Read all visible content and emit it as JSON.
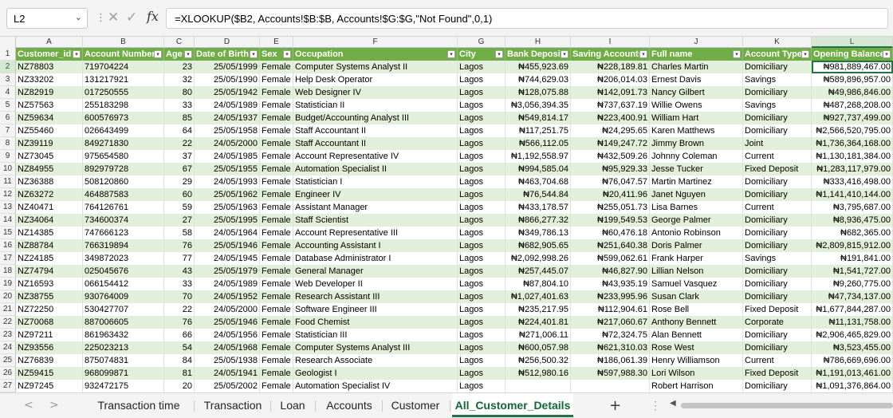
{
  "formula_bar": {
    "name_box": "L2",
    "name_box_arrow": "⌄",
    "separator": "⋮",
    "cancel_icon": "✕",
    "enter_icon": "✓",
    "fx": "fx",
    "formula": "=XLOOKUP($B2, Accounts!$B:$B, Accounts!$G:$G,\"Not Found\",0,1)"
  },
  "columns": [
    "A",
    "B",
    "C",
    "D",
    "E",
    "F",
    "G",
    "H",
    "I",
    "J",
    "K",
    "L"
  ],
  "selected_column": "L",
  "selected_row": 2,
  "headers": [
    "Customer_id",
    "Account Number",
    "Age",
    "Date of Birth",
    "Sex",
    "Occupation",
    "City",
    "Bank Deposit",
    "Saving Accounts",
    "Full name",
    "Account Type",
    "Opening Balance"
  ],
  "rows": [
    [
      "NZ78803",
      "719704224",
      "23",
      "25/05/1999",
      "Female",
      "Computer Systems Analyst II",
      "Lagos",
      "₦455,923.69",
      "₦228,189.81",
      "Charles Martin",
      "Domiciliary",
      "₦981,889,467.00"
    ],
    [
      "NZ33202",
      "131217921",
      "32",
      "25/05/1990",
      "Female",
      "Help Desk Operator",
      "Lagos",
      "₦744,629.03",
      "₦206,014.03",
      "Ernest Davis",
      "Savings",
      "₦589,896,957.00"
    ],
    [
      "NZ82919",
      "017250555",
      "80",
      "25/05/1942",
      "Female",
      "Web Designer IV",
      "Lagos",
      "₦128,075.88",
      "₦142,091.73",
      "Nancy Gilbert",
      "Domiciliary",
      "₦49,986,846.00"
    ],
    [
      "NZ57563",
      "255183298",
      "33",
      "24/05/1989",
      "Female",
      "Statistician II",
      "Lagos",
      "₦3,056,394.35",
      "₦737,637.19",
      "Willie Owens",
      "Savings",
      "₦487,268,208.00"
    ],
    [
      "NZ59634",
      "600576973",
      "85",
      "24/05/1937",
      "Female",
      "Budget/Accounting Analyst III",
      "Lagos",
      "₦549,814.17",
      "₦223,400.91",
      "William Hart",
      "Domiciliary",
      "₦927,737,499.00"
    ],
    [
      "NZ55460",
      "026643499",
      "64",
      "25/05/1958",
      "Female",
      "Staff Accountant II",
      "Lagos",
      "₦117,251.75",
      "₦24,295.65",
      "Karen Matthews",
      "Domiciliary",
      "₦2,566,520,795.00"
    ],
    [
      "NZ39119",
      "849271830",
      "22",
      "24/05/2000",
      "Female",
      "Staff Accountant II",
      "Lagos",
      "₦566,112.05",
      "₦149,247.72",
      "Jimmy Brown",
      "Joint",
      "₦1,736,364,168.00"
    ],
    [
      "NZ73045",
      "975654580",
      "37",
      "24/05/1985",
      "Female",
      "Account Representative IV",
      "Lagos",
      "₦1,192,558.97",
      "₦432,509.26",
      "Johnny Coleman",
      "Current",
      "₦1,130,181,384.00"
    ],
    [
      "NZ84955",
      "892979728",
      "67",
      "25/05/1955",
      "Female",
      "Automation Specialist II",
      "Lagos",
      "₦994,585.04",
      "₦95,929.33",
      "Jesse Tucker",
      "Fixed Deposit",
      "₦1,283,117,979.00"
    ],
    [
      "NZ36388",
      "508120860",
      "29",
      "24/05/1993",
      "Female",
      "Statistician I",
      "Lagos",
      "₦463,704.68",
      "₦76,047.57",
      "Martin Martinez",
      "Domiciliary",
      "₦333,416,498.00"
    ],
    [
      "NZ63272",
      "464887583",
      "60",
      "25/05/1962",
      "Female",
      "Engineer IV",
      "Lagos",
      "₦76,544.84",
      "₦20,411.96",
      "Janet Nguyen",
      "Domiciliary",
      "₦1,141,410,144.00"
    ],
    [
      "NZ40471",
      "764126761",
      "59",
      "25/05/1963",
      "Female",
      "Assistant Manager",
      "Lagos",
      "₦433,178.57",
      "₦255,051.73",
      "Lisa Barnes",
      "Current",
      "₦3,795,687.00"
    ],
    [
      "NZ34064",
      "734600374",
      "27",
      "25/05/1995",
      "Female",
      "Staff Scientist",
      "Lagos",
      "₦866,277.32",
      "₦199,549.53",
      "George Palmer",
      "Domiciliary",
      "₦8,936,475.00"
    ],
    [
      "NZ14385",
      "747666123",
      "58",
      "24/05/1964",
      "Female",
      "Account Representative III",
      "Lagos",
      "₦349,786.13",
      "₦60,476.18",
      "Antonio Robinson",
      "Domiciliary",
      "₦682,365.00"
    ],
    [
      "NZ88784",
      "766319894",
      "76",
      "25/05/1946",
      "Female",
      "Accounting Assistant I",
      "Lagos",
      "₦682,905.65",
      "₦251,640.38",
      "Doris Palmer",
      "Domiciliary",
      "₦2,809,815,912.00"
    ],
    [
      "NZ24185",
      "349872023",
      "77",
      "24/05/1945",
      "Female",
      "Database Administrator I",
      "Lagos",
      "₦2,092,998.26",
      "₦599,062.61",
      "Frank Harper",
      "Savings",
      "₦191,841.00"
    ],
    [
      "NZ74794",
      "025045676",
      "43",
      "25/05/1979",
      "Female",
      "General Manager",
      "Lagos",
      "₦257,445.07",
      "₦46,827.90",
      "Lillian Nelson",
      "Domiciliary",
      "₦1,541,727.00"
    ],
    [
      "NZ16593",
      "066154412",
      "33",
      "24/05/1989",
      "Female",
      "Web Developer II",
      "Lagos",
      "₦87,804.10",
      "₦43,935.19",
      "Samuel Vasquez",
      "Domiciliary",
      "₦9,260,775.00"
    ],
    [
      "NZ38755",
      "930764009",
      "70",
      "24/05/1952",
      "Female",
      "Research Assistant III",
      "Lagos",
      "₦1,027,401.63",
      "₦233,995.96",
      "Susan Clark",
      "Domiciliary",
      "₦47,734,137.00"
    ],
    [
      "NZ72250",
      "530427707",
      "22",
      "24/05/2000",
      "Female",
      "Software Engineer III",
      "Lagos",
      "₦235,217.95",
      "₦112,904.61",
      "Rose Bell",
      "Fixed Deposit",
      "₦1,677,844,287.00"
    ],
    [
      "NZ70068",
      "887006605",
      "76",
      "25/05/1946",
      "Female",
      "Food Chemist",
      "Lagos",
      "₦224,401.81",
      "₦217,060.67",
      "Anthony Bennett",
      "Corporate",
      "₦11,131,758.00"
    ],
    [
      "NZ97211",
      "861963432",
      "66",
      "24/05/1956",
      "Female",
      "Statistician III",
      "Lagos",
      "₦271,006.11",
      "₦72,324.75",
      "Alan Bennett",
      "Domiciliary",
      "₦2,906,465,829.00"
    ],
    [
      "NZ93556",
      "225023213",
      "54",
      "24/05/1968",
      "Female",
      "Computer Systems Analyst III",
      "Lagos",
      "₦600,057.98",
      "₦621,310.03",
      "Rose West",
      "Domiciliary",
      "₦3,523,455.00"
    ],
    [
      "NZ76839",
      "875074831",
      "84",
      "25/05/1938",
      "Female",
      "Research Associate",
      "Lagos",
      "₦256,500.32",
      "₦186,061.39",
      "Henry Williamson",
      "Current",
      "₦786,669,696.00"
    ],
    [
      "NZ59415",
      "968099871",
      "81",
      "24/05/1941",
      "Female",
      "Geologist I",
      "Lagos",
      "₦512,980.16",
      "₦597,988.30",
      "Lori Wilson",
      "Fixed Deposit",
      "₦1,191,013,461.00"
    ],
    [
      "NZ97245",
      "932472175",
      "20",
      "25/05/2002",
      "Female",
      "Automation Specialist IV",
      "Lagos",
      "",
      "",
      "Robert Harrison",
      "Domiciliary",
      "₦1,091,376,864.00"
    ]
  ],
  "tabs": [
    "Transaction time",
    "Transaction",
    "Loan",
    "Accounts",
    "Customer",
    "All_Customer_Details"
  ],
  "active_tab": "All_Customer_Details",
  "nav": {
    "prev": "<",
    "next": ">",
    "add": "+",
    "more": "⋮",
    "scroll_left": "◀"
  },
  "filter_glyph": "▾",
  "colors": {
    "header_green": "#70ad47",
    "band_green": "#e2efda",
    "excel_green": "#217346"
  }
}
